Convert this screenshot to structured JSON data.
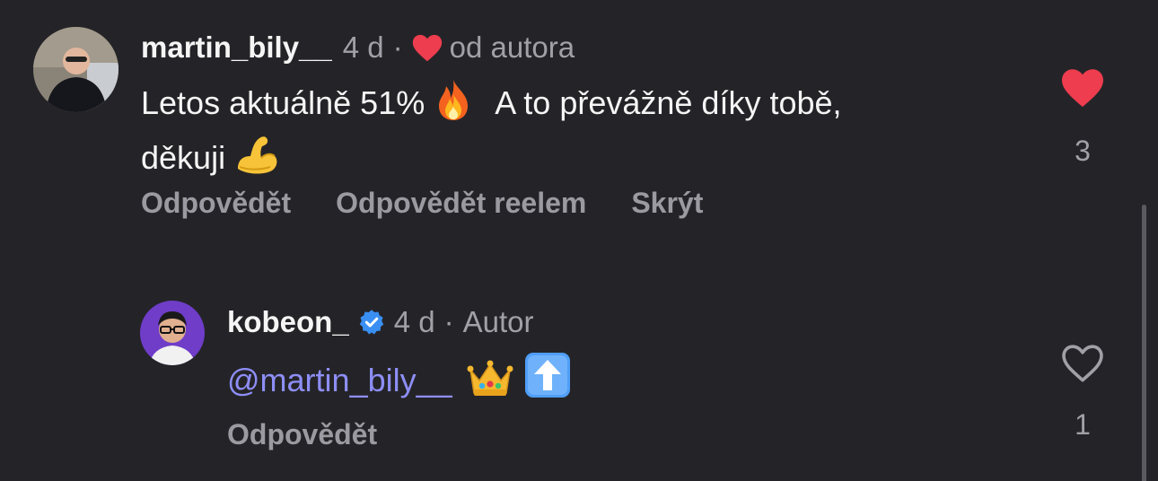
{
  "comments": [
    {
      "username": "martin_bily__",
      "age": "4 d",
      "separator": "·",
      "liked_by_author": "od autora",
      "text_part1": "Letos aktuálně 51%",
      "text_part2": "A to převážně díky tobě,",
      "text_part3": "děkuji",
      "emojis": [
        "fire-emoji",
        "flexed-biceps-emoji"
      ],
      "actions": [
        "Odpovědět",
        "Odpovědět reelem",
        "Skrýt"
      ],
      "like_count": "3",
      "liked": true,
      "like_color": "#ed3d4f"
    },
    {
      "username": "kobeon_",
      "verified": true,
      "age": "4 d",
      "separator": "·",
      "role": "Autor",
      "mention": "@martin_bily__",
      "emojis": [
        "crown-emoji",
        "up-arrow-emoji"
      ],
      "actions": [
        "Odpovědět"
      ],
      "like_count": "1",
      "liked": false
    }
  ],
  "colors": {
    "background": "#242428",
    "mention": "#8e8ef7",
    "verified": "#3a8ff2",
    "muted": "#a0a0a6"
  }
}
